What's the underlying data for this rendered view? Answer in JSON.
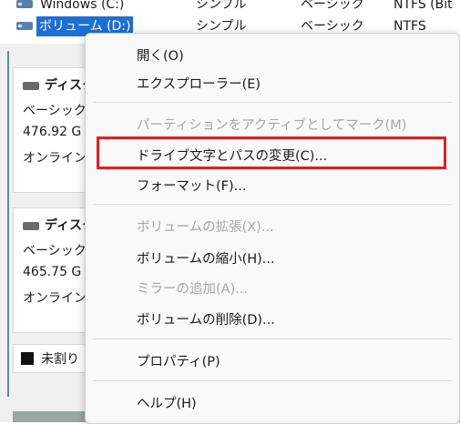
{
  "volumes": [
    {
      "name": "Windows (C:)",
      "layout": "シンプル",
      "type": "ベーシック",
      "fs": "NTFS (Bit"
    },
    {
      "name": "ボリューム (D:)",
      "layout": "シンプル",
      "type": "ベーシック",
      "fs": "NTFS"
    }
  ],
  "disks": [
    {
      "title": "ディスク",
      "type": "ベーシック",
      "size": "476.92 G",
      "status": "オンライン"
    },
    {
      "title": "ディスク",
      "type": "ベーシック",
      "size": "465.75 G",
      "status": "オンライン"
    }
  ],
  "unallocated_label": "未割り",
  "menu": {
    "open": "開く(O)",
    "explorer": "エクスプローラー(E)",
    "mark_active": "パーティションをアクティブとしてマーク(M)",
    "change_letter": "ドライブ文字とパスの変更(C)...",
    "format": "フォーマット(F)...",
    "extend": "ボリュームの拡張(X)...",
    "shrink": "ボリュームの縮小(H)...",
    "add_mirror": "ミラーの追加(A)...",
    "delete": "ボリュームの削除(D)...",
    "properties": "プロパティ(P)",
    "help": "ヘルプ(H)"
  },
  "colors": {
    "selection": "#1f6fd1",
    "highlight_box": "#e02020",
    "disabled_text": "#a6a6a6"
  }
}
